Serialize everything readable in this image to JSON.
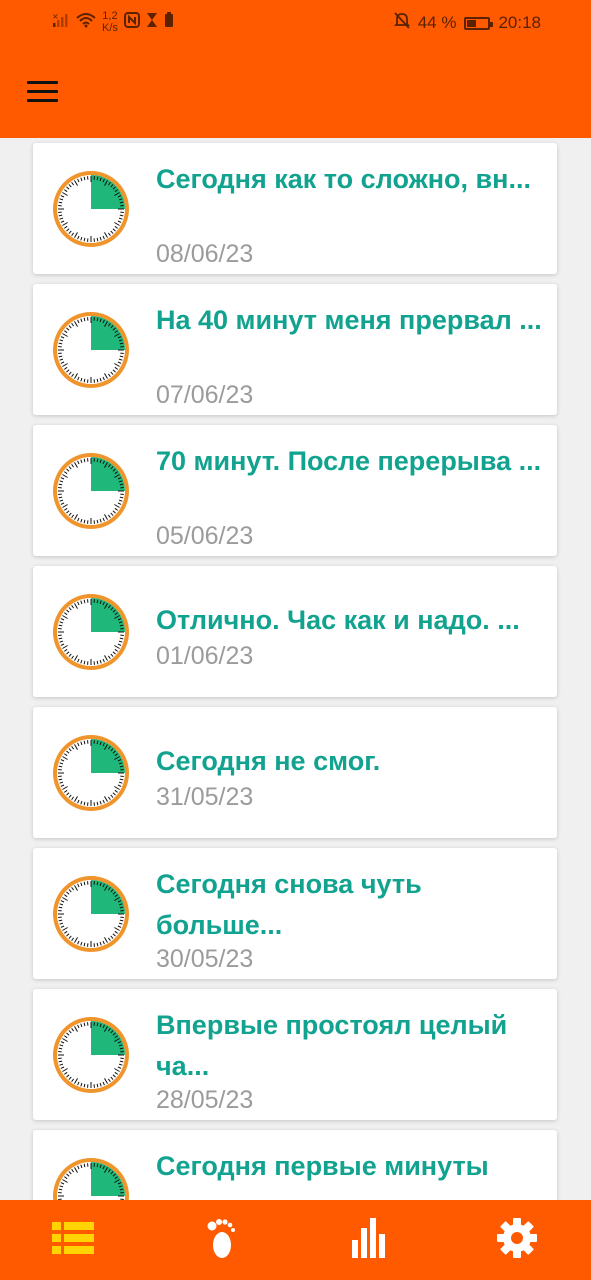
{
  "status": {
    "net_speed": "1,2\nK/s",
    "battery_percent": "44 %",
    "battery_level": 0.44,
    "time": "20:18"
  },
  "colors": {
    "header": "#ff5a00",
    "title": "#11a38f",
    "date": "#9b9b9b",
    "clock_ring": "#f0952c",
    "clock_fill": "#1fb87a",
    "nav_active": "#ffd400"
  },
  "header": {
    "menu_icon": "hamburger-menu-icon"
  },
  "entries": [
    {
      "title": "Сегодня как то сложно, вн...",
      "date": "08/06/23"
    },
    {
      "title": "На 40 минут меня прервал ...",
      "date": "07/06/23"
    },
    {
      "title": "70 минут. После перерыва ...",
      "date": "05/06/23"
    },
    {
      "title": "Отлично. Час как и надо. ...",
      "date": "01/06/23"
    },
    {
      "title": "Сегодня не смог.",
      "date": "31/05/23"
    },
    {
      "title": "Сегодня снова чуть больше...",
      "date": "30/05/23"
    },
    {
      "title": "Впервые простоял целый ча...",
      "date": "28/05/23"
    },
    {
      "title": "Сегодня первые минуты",
      "date": ""
    }
  ],
  "bottom_nav": [
    {
      "icon": "list-icon",
      "active": true
    },
    {
      "icon": "footprint-icon",
      "active": false
    },
    {
      "icon": "bar-chart-icon",
      "active": false
    },
    {
      "icon": "gear-icon",
      "active": false
    }
  ]
}
